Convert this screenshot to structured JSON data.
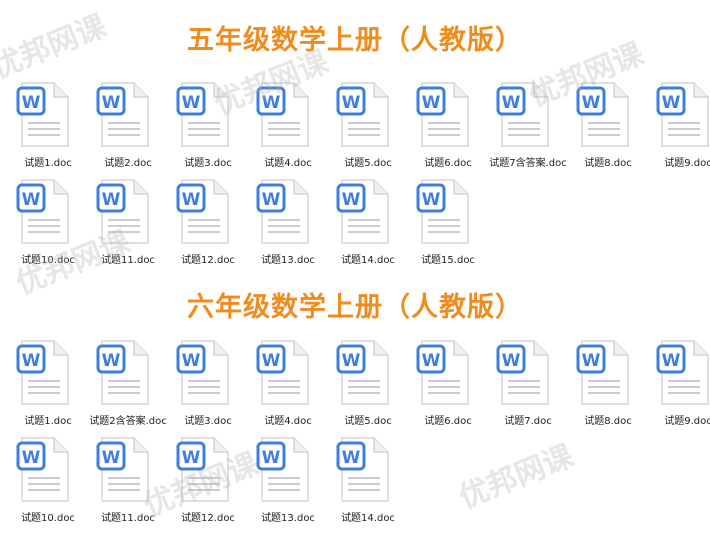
{
  "accent_color": "#f08c1e",
  "icon": {
    "name": "word-doc-icon",
    "glyph": "W",
    "color": "#3d7fe0"
  },
  "watermark_text": "优邦网课",
  "sections": [
    {
      "title": "五年级数学上册（人教版）",
      "files": [
        "试题1.doc",
        "试题2.doc",
        "试题3.doc",
        "试题4.doc",
        "试题5.doc",
        "试题6.doc",
        "试题7含答案.doc",
        "试题8.doc",
        "试题9.doc",
        "试题10.doc",
        "试题11.doc",
        "试题12.doc",
        "试题13.doc",
        "试题14.doc",
        "试题15.doc"
      ]
    },
    {
      "title": "六年级数学上册（人教版）",
      "files": [
        "试题1.doc",
        "试题2含答案.doc",
        "试题3.doc",
        "试题4.doc",
        "试题5.doc",
        "试题6.doc",
        "试题7.doc",
        "试题8.doc",
        "试题9.doc",
        "试题10.doc",
        "试题11.doc",
        "试题12.doc",
        "试题13.doc",
        "试题14.doc"
      ]
    }
  ]
}
